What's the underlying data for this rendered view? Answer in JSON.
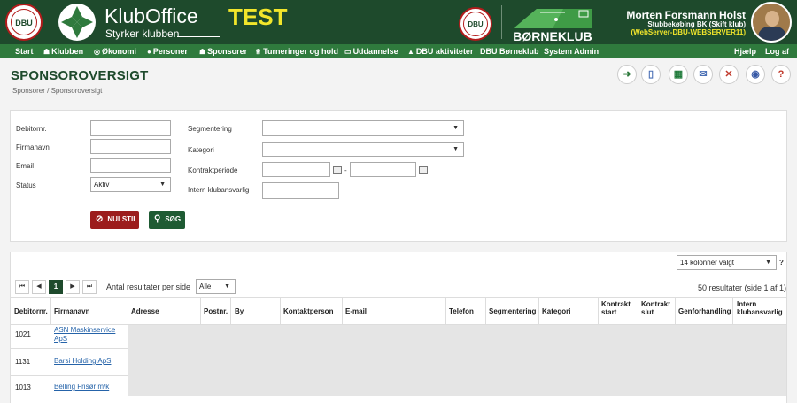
{
  "header": {
    "app_name": "KlubOffice",
    "app_tagline": "Styrker klubben",
    "env_label": "TEST",
    "dbu_badge": "DBU",
    "borneklub_label": "BØRNEKLUB",
    "user_name": "Morten Forsmann Holst",
    "user_club": "Stubbekøbing BK (Skift klub)",
    "user_server": "(WebServer-DBU-WEBSERVER11)"
  },
  "nav": {
    "items": [
      "Start",
      "Klubben",
      "Økonomi",
      "Personer",
      "Sponsorer",
      "Turneringer og hold",
      "Uddannelse",
      "DBU aktiviteter",
      "DBU Børneklub",
      "System Admin"
    ],
    "help": "Hjælp",
    "logout": "Log af"
  },
  "page": {
    "title": "SPONSOROVERSIGT",
    "breadcrumb": "Sponsorer / Sponsoroversigt"
  },
  "toolbar_icons": [
    "back-icon",
    "document-icon",
    "excel-icon",
    "mail-icon",
    "close-icon",
    "info-icon",
    "help-icon"
  ],
  "filter": {
    "debitor_label": "Debitornr.",
    "firma_label": "Firmanavn",
    "email_label": "Email",
    "status_label": "Status",
    "status_value": "Aktiv",
    "segment_label": "Segmentering",
    "kategori_label": "Kategori",
    "kontrakt_label": "Kontraktperiode",
    "kontrakt_sep": "-",
    "intern_label": "Intern klubansvarlig",
    "reset_button": "NULSTIL",
    "search_button": "SØG"
  },
  "results": {
    "columns_selected": "14 kolonner valgt",
    "help_mark": "?",
    "page_number": "1",
    "per_page_label": "Antal resultater per side",
    "per_page_value": "Alle",
    "summary": "50 resultater (side 1 af 1)"
  },
  "table": {
    "headers": [
      "Debitornr.",
      "Firmanavn",
      "Adresse",
      "Postnr.",
      "By",
      "Kontaktperson",
      "E-mail",
      "Telefon",
      "Segmentering",
      "Kategori",
      "Kontrakt start",
      "Kontrakt slut",
      "Genforhandling",
      "Intern klubansvarlig"
    ],
    "rows": [
      {
        "debitor": "1021",
        "firma": "ASN Maskinservice ApS"
      },
      {
        "debitor": "1131",
        "firma": "Barsi Holding ApS"
      },
      {
        "debitor": "1013",
        "firma": "Belling Frisør m/k"
      }
    ]
  },
  "colors": {
    "header_bg": "#1e4a2c",
    "nav_bg": "#2f7a3d",
    "test_yellow": "#f2e62b",
    "reset_red": "#9c1c1c",
    "search_green": "#1e5b33",
    "link_blue": "#2563a9"
  }
}
